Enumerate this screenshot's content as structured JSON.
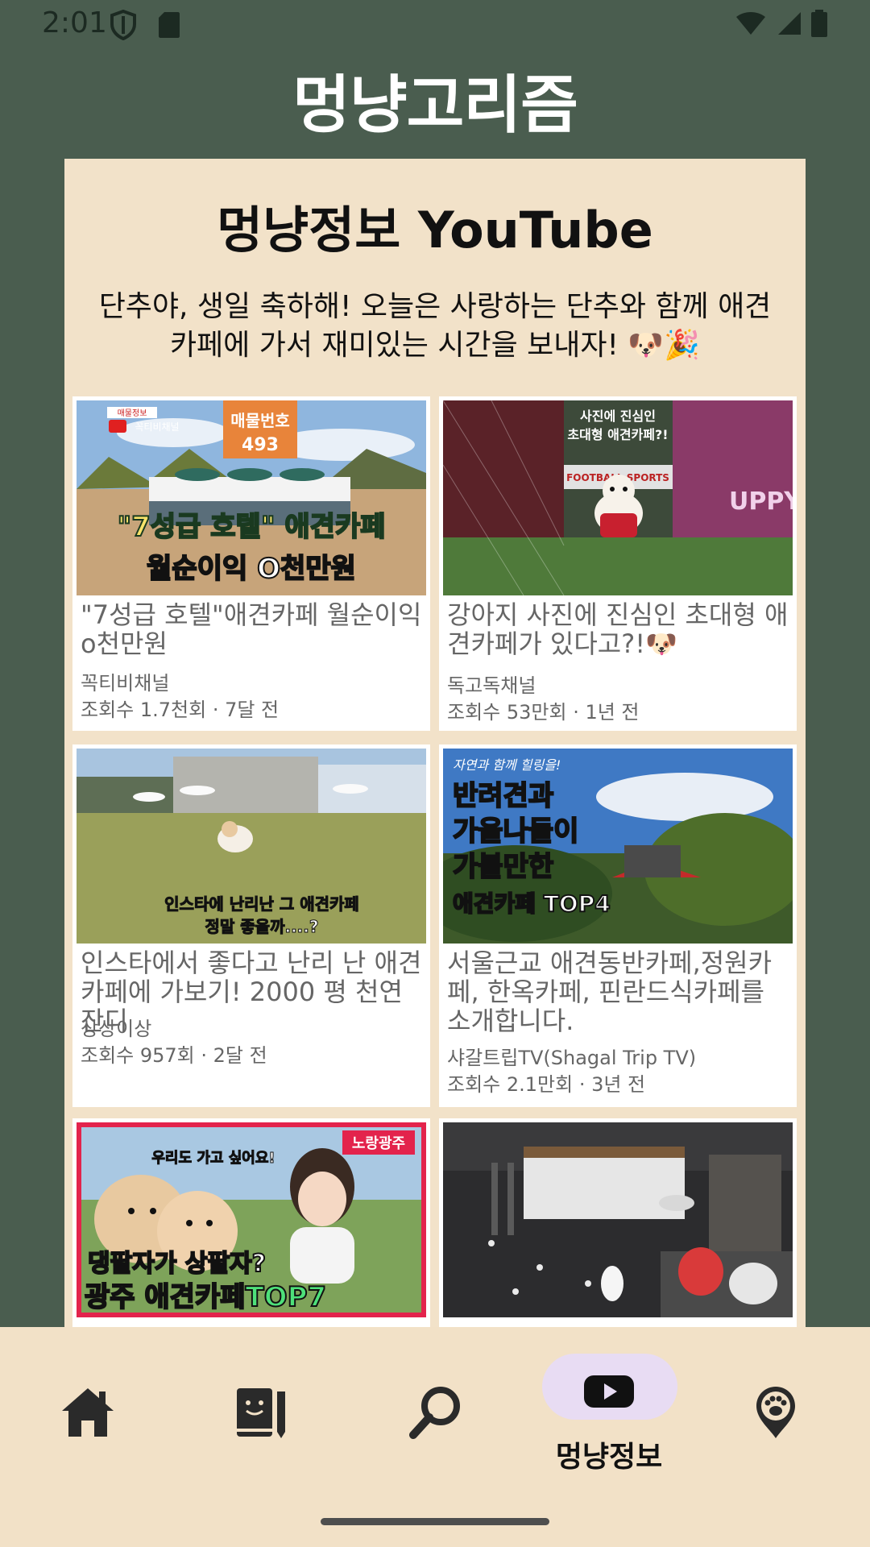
{
  "status": {
    "time": "2:01"
  },
  "app": {
    "title": "멍냥고리즘"
  },
  "panel": {
    "title": "멍냥정보 YouTube",
    "message": "단추야, 생일 축하해! 오늘은 사랑하는 단추와 함께 애견카페에 가서 재미있는 시간을 보내자! 🐶🎉"
  },
  "videos": [
    {
      "title": "\"7성급 호텔\"애견카페 월순이익 o천만원",
      "channel": "꼭티비채널",
      "meta": "조회수 1.7천회 · 7달 전",
      "thumb_text": [
        "매물번호",
        "493",
        "\"7성급 호텔\" 애견카페",
        "월순이익 O천만원",
        "꼭티비채널",
        "매물정보"
      ]
    },
    {
      "title": "강아지 사진에 진심인 초대형 애견카페가 있다고?!🐶",
      "channel": "독고독채널",
      "meta": "조회수 53만회 · 1년 전",
      "thumb_text": [
        "사진에 진심인",
        "초대형 애견카페?!",
        "FOOTBALL SPORTS",
        "UPPY"
      ]
    },
    {
      "title": "인스타에서 좋다고 난리 난 애견카페에 가보기! 2000 평 천연 잔디",
      "channel": "상상이상",
      "meta": "조회수 957회 · 2달 전",
      "thumb_text": [
        "인스타에 난리난 그 애견카페",
        "정말 좋을까....?"
      ]
    },
    {
      "title": "서울근교 애견동반카페,정원카페, 한옥카페, 핀란드식카페를 소개합니다.",
      "channel": "샤갈트립TV(Shagal Trip TV)",
      "meta": "조회수 2.1만회 · 3년 전",
      "thumb_text": [
        "반려견과",
        "가을나들이",
        "가볼만한",
        "애견카페 TOP4",
        "자연과 함께 힐링을!"
      ]
    },
    {
      "title": "",
      "channel": "",
      "meta": "",
      "thumb_text": [
        "댕팔자가 상팔자?",
        "광주 애견카페TOP7",
        "우리도 가고 싶어요!",
        "노랑광주"
      ]
    },
    {
      "title": "",
      "channel": "",
      "meta": "",
      "thumb_text": []
    }
  ],
  "nav": {
    "items": [
      {
        "icon": "home-icon"
      },
      {
        "icon": "diary-icon"
      },
      {
        "icon": "search-icon"
      },
      {
        "icon": "youtube-icon",
        "label": "멍냥정보",
        "selected": true
      },
      {
        "icon": "paw-pin-icon"
      }
    ]
  },
  "colors": {
    "background": "#4a5d4f",
    "panel": "#f2e2c9",
    "nav_bg": "#f2e1c7",
    "nav_selected_pill": "#e8dcf3"
  }
}
